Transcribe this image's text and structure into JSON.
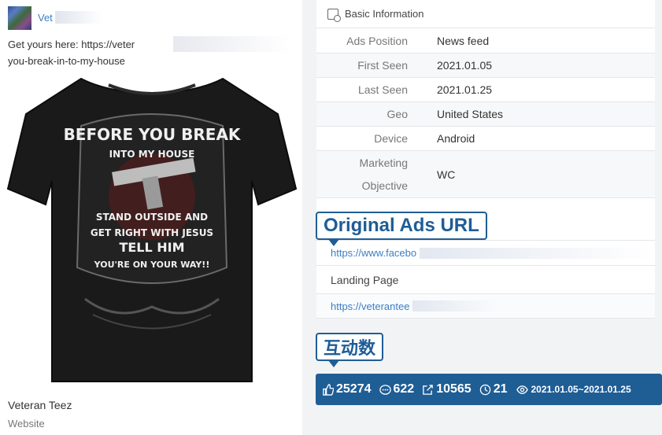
{
  "post": {
    "author": "Vet",
    "caption": "Get yours here: https://veter…you-break-in-to-my-house",
    "caption_line1": "Get yours here: https://veter",
    "caption_line2": "you-break-in-to-my-house",
    "shirt_text": [
      "BEFORE YOU BREAK",
      "INTO MY HOUSE",
      "STAND OUTSIDE AND",
      "GET RIGHT WITH JESUS",
      "TELL HIM",
      "YOU'RE ON YOUR WAY!!"
    ],
    "page_name": "Veteran Teez",
    "page_type": "Website"
  },
  "info": {
    "title": "Basic Information",
    "rows": [
      {
        "key": "Ads Position",
        "value": "News feed"
      },
      {
        "key": "First Seen",
        "value": "2021.01.05"
      },
      {
        "key": "Last Seen",
        "value": "2021.01.25"
      },
      {
        "key": "Geo",
        "value": "United States"
      },
      {
        "key": "Device",
        "value": "Android"
      },
      {
        "key": "Marketing\nObjective",
        "value": "WC"
      }
    ]
  },
  "urls": {
    "original_value": "https://www.facebo",
    "landing_label": "Landing Page",
    "landing_value": "https://veterantee"
  },
  "callouts": {
    "original_ads_url": "Original Ads URL",
    "engagement": "互动数"
  },
  "stats": {
    "likes": "25274",
    "comments": "622",
    "shares": "10565",
    "days": "21",
    "date_range": "2021.01.05~2021.01.25"
  },
  "colors": {
    "accent": "#1f5d95",
    "link": "#3b7fc4",
    "panel_bg": "#f2f3f5"
  }
}
